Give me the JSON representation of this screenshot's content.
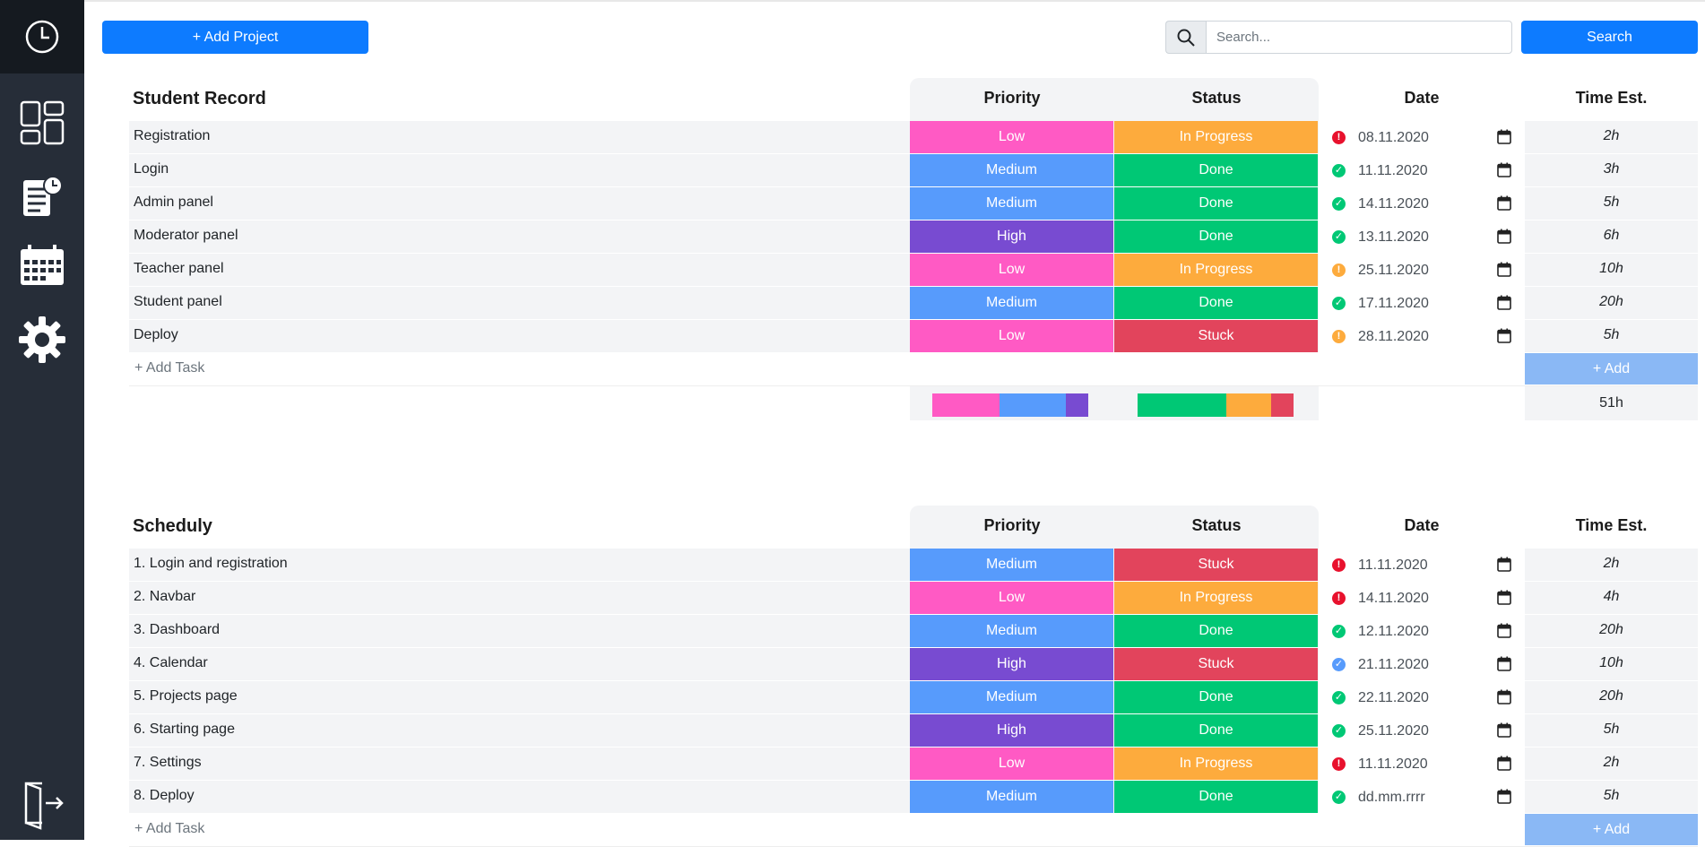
{
  "colors": {
    "low": "#ff5ac4",
    "medium": "#579bfc",
    "high": "#784bd1",
    "in_progress": "#fdab3d",
    "done": "#00c875",
    "stuck": "#e2445c",
    "alert_red": "#e8112d",
    "check_green": "#00c875",
    "alert_orange": "#fdab3d",
    "check_blue": "#579bfc"
  },
  "sidebar": {
    "icons": [
      "clock-icon",
      "dashboard-icon",
      "projects-icon",
      "calendar-icon",
      "settings-icon",
      "logout-icon"
    ]
  },
  "toolbar": {
    "add_project_label": "+ Add Project",
    "search_placeholder": "Search...",
    "search_value": "",
    "search_button_label": "Search"
  },
  "columns": {
    "priority": "Priority",
    "status": "Status",
    "date": "Date",
    "time": "Time Est."
  },
  "projects": [
    {
      "title": "Student Record",
      "add_task_label": "+ Add Task",
      "add_button_label": "+ Add",
      "total_time": "51h",
      "priority_summary": [
        {
          "key": "low",
          "share": 3
        },
        {
          "key": "medium",
          "share": 3
        },
        {
          "key": "high",
          "share": 1
        }
      ],
      "status_summary": [
        {
          "key": "done",
          "share": 4
        },
        {
          "key": "in_progress",
          "share": 2
        },
        {
          "key": "stuck",
          "share": 1
        }
      ],
      "tasks": [
        {
          "name": "Registration",
          "priority": "Low",
          "pkey": "low",
          "status": "In Progress",
          "skey": "in_progress",
          "icon": "alert_red",
          "date": "08.11.2020",
          "time": "2h"
        },
        {
          "name": "Login",
          "priority": "Medium",
          "pkey": "medium",
          "status": "Done",
          "skey": "done",
          "icon": "check_green",
          "date": "11.11.2020",
          "time": "3h"
        },
        {
          "name": "Admin panel",
          "priority": "Medium",
          "pkey": "medium",
          "status": "Done",
          "skey": "done",
          "icon": "check_green",
          "date": "14.11.2020",
          "time": "5h"
        },
        {
          "name": "Moderator panel",
          "priority": "High",
          "pkey": "high",
          "status": "Done",
          "skey": "done",
          "icon": "check_green",
          "date": "13.11.2020",
          "time": "6h"
        },
        {
          "name": "Teacher panel",
          "priority": "Low",
          "pkey": "low",
          "status": "In Progress",
          "skey": "in_progress",
          "icon": "alert_orange",
          "date": "25.11.2020",
          "time": "10h"
        },
        {
          "name": "Student panel",
          "priority": "Medium",
          "pkey": "medium",
          "status": "Done",
          "skey": "done",
          "icon": "check_green",
          "date": "17.11.2020",
          "time": "20h"
        },
        {
          "name": "Deploy",
          "priority": "Low",
          "pkey": "low",
          "status": "Stuck",
          "skey": "stuck",
          "icon": "alert_orange",
          "date": "28.11.2020",
          "time": "5h"
        }
      ]
    },
    {
      "title": "Scheduly",
      "add_task_label": "+ Add Task",
      "add_button_label": "+ Add",
      "total_time": "",
      "tasks": [
        {
          "name": "1. Login and registration",
          "priority": "Medium",
          "pkey": "medium",
          "status": "Stuck",
          "skey": "stuck",
          "icon": "alert_red",
          "date": "11.11.2020",
          "time": "2h"
        },
        {
          "name": "2. Navbar",
          "priority": "Low",
          "pkey": "low",
          "status": "In Progress",
          "skey": "in_progress",
          "icon": "alert_red",
          "date": "14.11.2020",
          "time": "4h"
        },
        {
          "name": "3. Dashboard",
          "priority": "Medium",
          "pkey": "medium",
          "status": "Done",
          "skey": "done",
          "icon": "check_green",
          "date": "12.11.2020",
          "time": "20h"
        },
        {
          "name": "4. Calendar",
          "priority": "High",
          "pkey": "high",
          "status": "Stuck",
          "skey": "stuck",
          "icon": "check_blue",
          "date": "21.11.2020",
          "time": "10h"
        },
        {
          "name": "5. Projects page",
          "priority": "Medium",
          "pkey": "medium",
          "status": "Done",
          "skey": "done",
          "icon": "check_green",
          "date": "22.11.2020",
          "time": "20h"
        },
        {
          "name": "6. Starting page",
          "priority": "High",
          "pkey": "high",
          "status": "Done",
          "skey": "done",
          "icon": "check_green",
          "date": "25.11.2020",
          "time": "5h"
        },
        {
          "name": "7. Settings",
          "priority": "Low",
          "pkey": "low",
          "status": "In Progress",
          "skey": "in_progress",
          "icon": "alert_red",
          "date": "11.11.2020",
          "time": "2h"
        },
        {
          "name": "8. Deploy",
          "priority": "Medium",
          "pkey": "medium",
          "status": "Done",
          "skey": "done",
          "icon": "check_green",
          "date": "dd.mm.rrrr",
          "time": "5h"
        }
      ]
    }
  ]
}
